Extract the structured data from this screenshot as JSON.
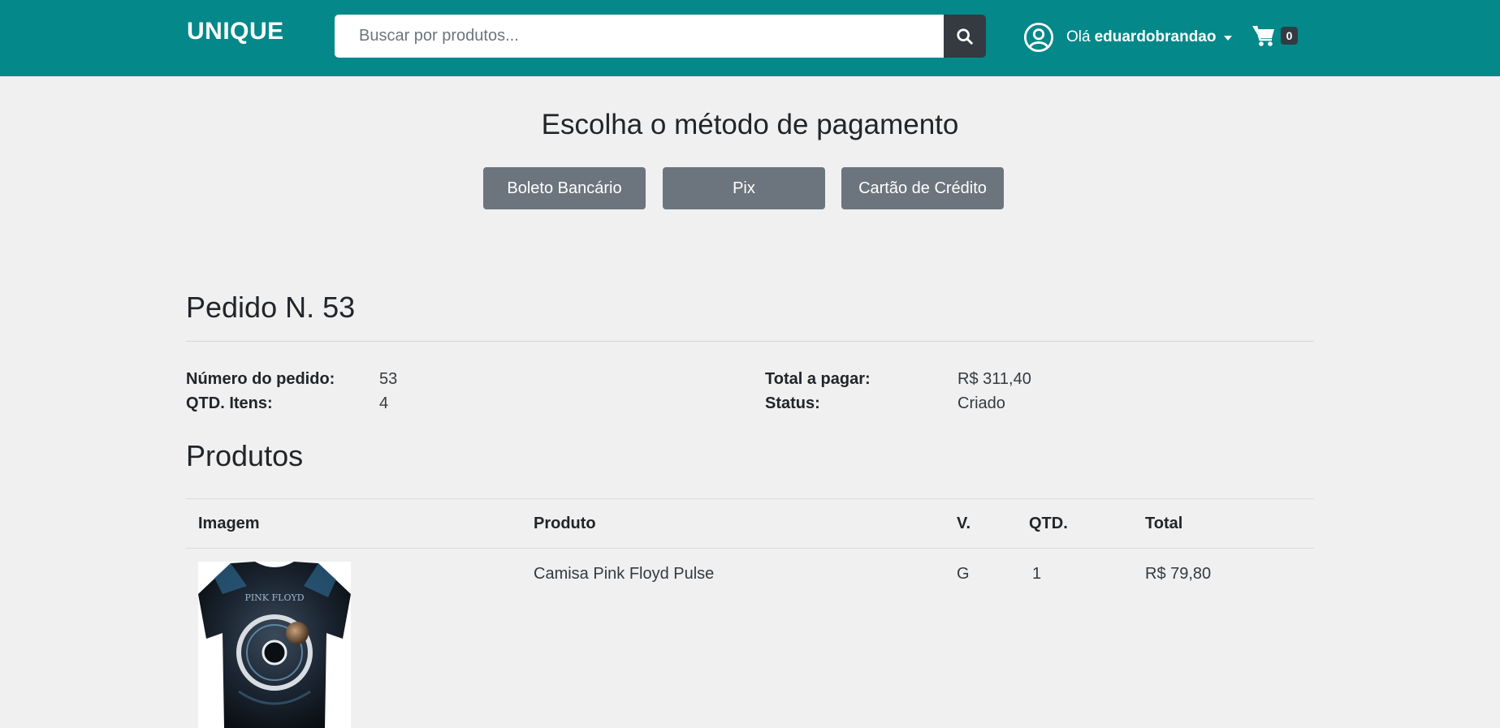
{
  "header": {
    "brand": "UNIQUE",
    "search_placeholder": "Buscar por produtos...",
    "greeting": "Olá",
    "username": "eduardobrandao",
    "cart_count": "0",
    "icons": {
      "search": "search-icon",
      "user": "user-circle-icon",
      "cart": "cart-icon",
      "dropdown": "caret-down-icon"
    }
  },
  "payment": {
    "title": "Escolha o método de pagamento",
    "methods": [
      "Boleto Bancário",
      "Pix",
      "Cartão de Crédito"
    ]
  },
  "order": {
    "title": "Pedido N. 53",
    "number_label": "Número do pedido:",
    "number_value": "53",
    "items_label": "QTD. Itens:",
    "items_value": "4",
    "total_label": "Total a pagar:",
    "total_value": "R$ 311,40",
    "status_label": "Status:",
    "status_value": "Criado"
  },
  "products": {
    "title": "Produtos",
    "columns": [
      "Imagem",
      "Produto",
      "V.",
      "QTD.",
      "Total"
    ],
    "rows": [
      {
        "name": "Camisa Pink Floyd Pulse",
        "variant": "G",
        "qty": "1",
        "total": "R$ 79,80"
      }
    ]
  },
  "colors": {
    "navbar": "#04888a",
    "button": "#6c757d",
    "dark": "#343a40"
  }
}
